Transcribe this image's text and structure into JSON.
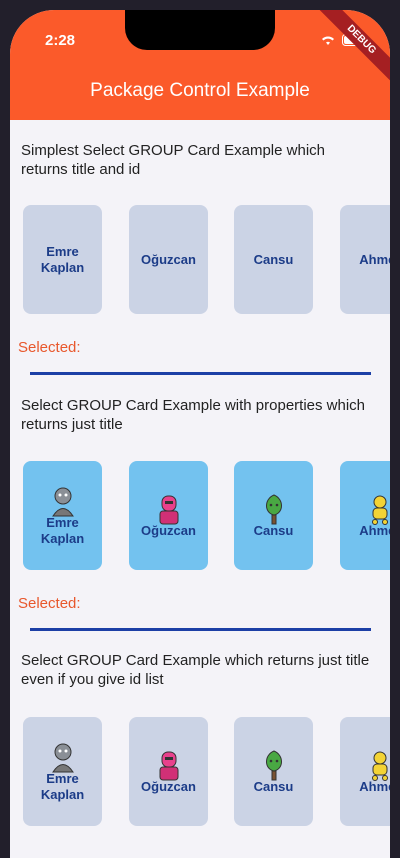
{
  "status_bar": {
    "time": "2:28"
  },
  "app_bar": {
    "title": "Package Control Example",
    "debug_banner": "DEBUG",
    "color": "#fb5a2a"
  },
  "sections": [
    {
      "title": "Simplest Select GROUP Card Example which returns title and id",
      "cards": [
        "Emre Kaplan",
        "Oğuzcan",
        "Cansu",
        "Ahmet"
      ],
      "selected_label": "Selected:"
    },
    {
      "title": "Select GROUP Card Example with properties which returns just title",
      "cards": [
        "Emre Kaplan",
        "Oğuzcan",
        "Cansu",
        "Ahmet"
      ],
      "avatars": [
        "grey-character-icon",
        "pink-character-icon",
        "green-tree-character-icon",
        "yellow-robot-character-icon"
      ],
      "selected_label": "Selected:"
    },
    {
      "title": "Select GROUP Card Example which returns just title even if you give id list",
      "cards": [
        "Emre Kaplan",
        "Oğuzcan",
        "Cansu",
        "Ahmet"
      ],
      "avatars": [
        "grey-character-icon",
        "pink-character-icon",
        "green-tree-character-icon",
        "yellow-robot-character-icon"
      ]
    }
  ]
}
